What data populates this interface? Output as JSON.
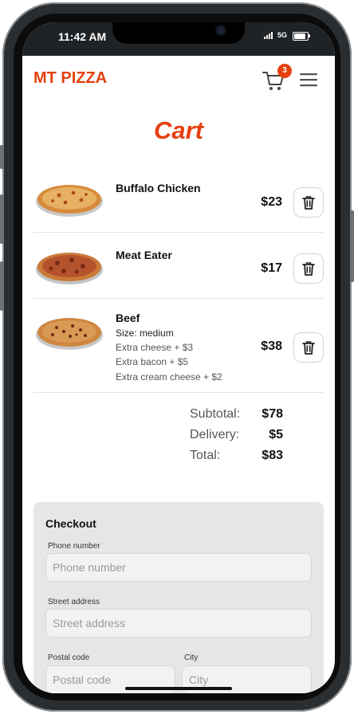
{
  "status_bar": {
    "time": "11:42 AM",
    "network": "5G"
  },
  "header": {
    "brand": "MT PIZZA",
    "cart_count": "3"
  },
  "page": {
    "title": "Cart"
  },
  "cart_items": [
    {
      "name": "Buffalo Chicken",
      "price": "$23",
      "size": "",
      "extras": []
    },
    {
      "name": "Meat Eater",
      "price": "$17",
      "size": "",
      "extras": []
    },
    {
      "name": "Beef",
      "price": "$38",
      "size": "Size: medium",
      "extras": [
        "Extra cheese + $3",
        "Extra bacon + $5",
        "Extra cream cheese + $2"
      ]
    }
  ],
  "summary": {
    "subtotal_label": "Subtotal:",
    "subtotal": "$78",
    "delivery_label": "Delivery:",
    "delivery": "$5",
    "total_label": "Total:",
    "total": "$83"
  },
  "checkout": {
    "title": "Checkout",
    "phone": {
      "label": "Phone number",
      "placeholder": "Phone number"
    },
    "street": {
      "label": "Street address",
      "placeholder": "Street address"
    },
    "postal": {
      "label": "Postal code",
      "placeholder": "Postal code"
    },
    "city": {
      "label": "City",
      "placeholder": "City"
    }
  },
  "colors": {
    "accent": "#e5400f",
    "checkout_bg": "#e6e6e8"
  },
  "icons": [
    "cart-icon",
    "menu-icon",
    "trash-icon",
    "pizza-image"
  ]
}
